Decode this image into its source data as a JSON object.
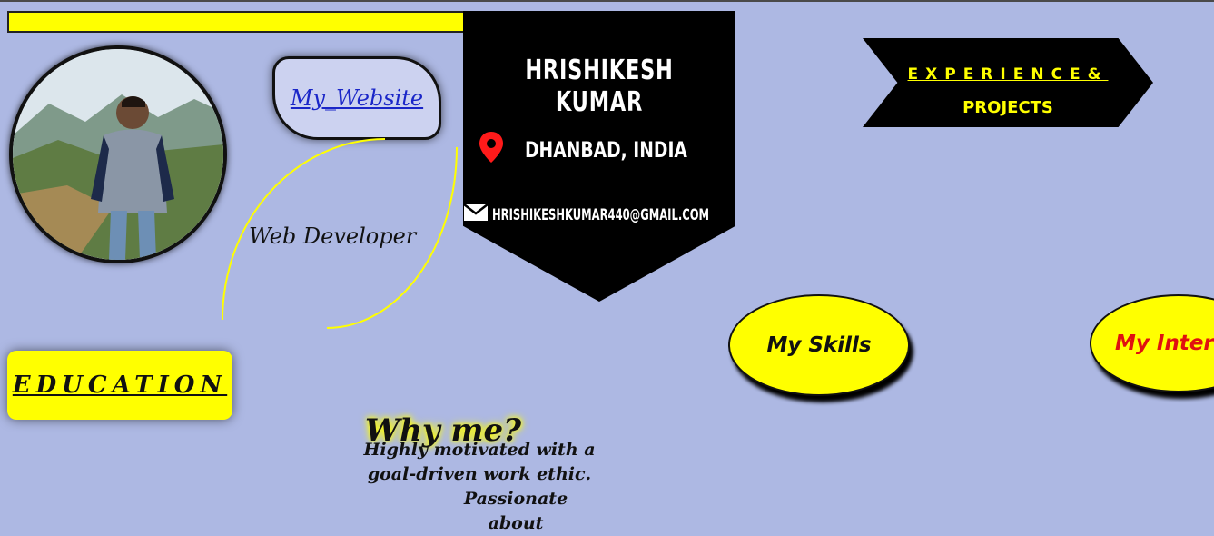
{
  "profile": {
    "name": "HRISHIKESH KUMAR",
    "location": "DHANBAD, INDIA",
    "email": "HRISHIKESHKUMAR440@GMAIL.COM",
    "role": "Web Developer",
    "website_label": "My_Website"
  },
  "nav": {
    "experience_line1": "EXPERIENCE&",
    "experience_line2": "PROJECTS",
    "skills_label": "My Skills",
    "interests_label": "My Intere",
    "education_label": "EDUCATION"
  },
  "why": {
    "heading": "Why me?",
    "lines": [
      "Highly motivated with a",
      "goal-driven work ethic.",
      "Passionate about"
    ]
  },
  "colors": {
    "background": "#adb8e3",
    "accent": "#ffff00",
    "banner": "#000000",
    "link": "#1a26c8",
    "interests_text": "#e01010"
  },
  "icons": {
    "location": "map-pin-icon",
    "email": "envelope-icon"
  }
}
